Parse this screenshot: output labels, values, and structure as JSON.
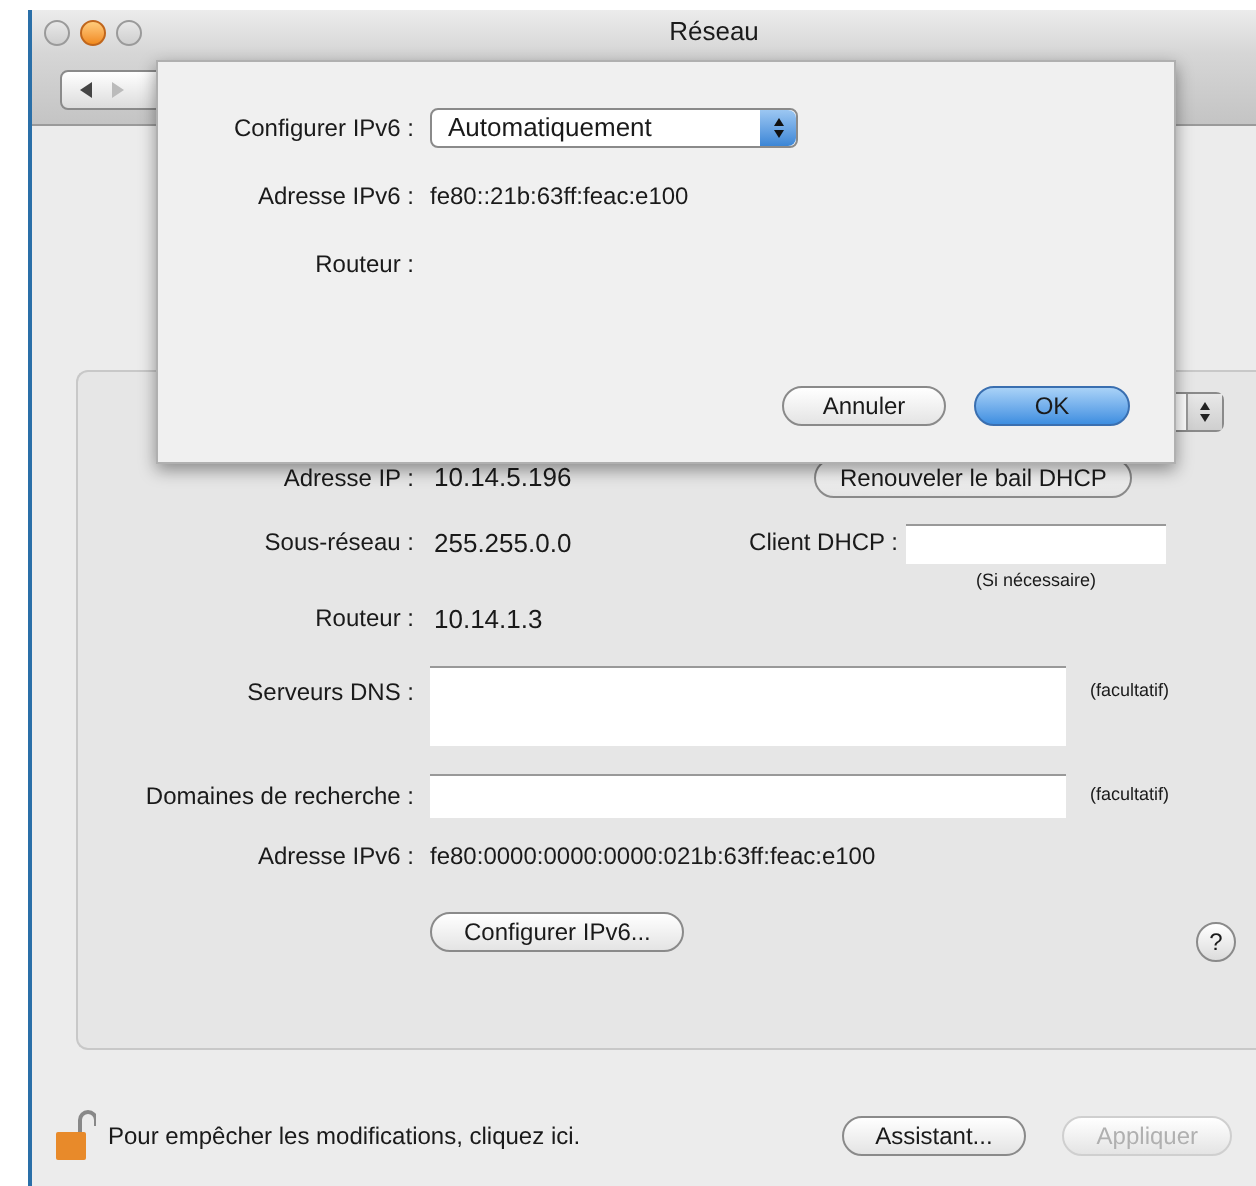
{
  "window": {
    "title": "Réseau"
  },
  "sheet": {
    "fields": [
      {
        "kind": "popup",
        "label": "Configurer IPv6 :",
        "value": "Automatiquement"
      },
      {
        "kind": "text",
        "label": "Adresse IPv6 :",
        "value": "fe80::21b:63ff:feac:e100"
      },
      {
        "kind": "text",
        "label": "Routeur :"
      }
    ],
    "buttons": [
      {
        "label": "Annuler",
        "default": false
      },
      {
        "label": "OK",
        "default": true
      }
    ]
  },
  "panel": {
    "ip": {
      "label": "Adresse IP :",
      "value": "10.14.5.196",
      "button": "Renouveler le bail DHCP"
    },
    "subnet": {
      "label": "Sous-réseau :",
      "value": "255.255.0.0",
      "client_label": "Client DHCP :",
      "client_hint": "(Si nécessaire)"
    },
    "router": {
      "label": "Routeur :",
      "value": "10.14.1.3"
    },
    "dns": {
      "label": "Serveurs DNS :",
      "note": "(facultatif)"
    },
    "search_domains": {
      "label": "Domaines de recherche :",
      "note": "(facultatif)"
    },
    "ipv6": {
      "label": "Adresse IPv6 :",
      "value": "fe80:0000:0000:0000:021b:63ff:feac:e100"
    },
    "configure_button": "Configurer IPv6...",
    "help": "?"
  },
  "bottom": {
    "lock_text": "Pour empêcher les modifications, cliquez ici.",
    "buttons": [
      {
        "label": "Assistant...",
        "disabled": false
      },
      {
        "label": "Appliquer",
        "disabled": true
      }
    ]
  }
}
